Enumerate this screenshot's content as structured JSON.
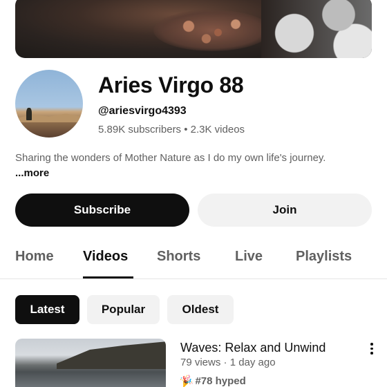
{
  "channel": {
    "name": "Aries Virgo 88",
    "handle": "@ariesvirgo4393",
    "subscribers": "5.89K subscribers",
    "separator": " • ",
    "videos_count": "2.3K videos",
    "description": "Sharing the wonders of Mother Nature as I do my own life's journey.",
    "more_label": "...more"
  },
  "actions": {
    "subscribe_label": "Subscribe",
    "join_label": "Join"
  },
  "tabs": [
    {
      "label": "Home",
      "active": false
    },
    {
      "label": "Videos",
      "active": true
    },
    {
      "label": "Shorts",
      "active": false
    },
    {
      "label": "Live",
      "active": false
    },
    {
      "label": "Playlists",
      "active": false
    }
  ],
  "filters": [
    {
      "label": "Latest",
      "selected": true
    },
    {
      "label": "Popular",
      "selected": false
    },
    {
      "label": "Oldest",
      "selected": false
    }
  ],
  "videos": [
    {
      "title": "Waves: Relax and Unwind",
      "meta": "79 views · 1 day ago",
      "hype": "#78 hyped"
    }
  ],
  "colors": {
    "primary_text": "#0f0f0f",
    "secondary_text": "#606060",
    "chip_bg": "#f2f2f2",
    "active_bg": "#0f0f0f"
  },
  "icons": {
    "more_options": "kebab-menu-icon",
    "hype": "hype-icon"
  }
}
